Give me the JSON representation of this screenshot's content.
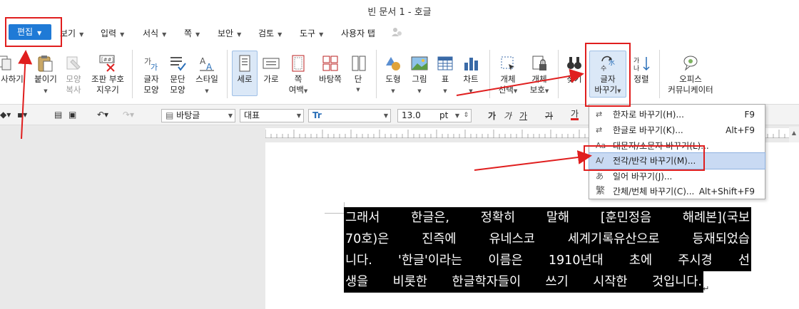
{
  "window": {
    "title": "빈 문서 1 - 호글"
  },
  "menu": {
    "edit": "편집",
    "items": [
      "보기",
      "입력",
      "서식",
      "쪽",
      "보안",
      "검토",
      "도구",
      "사용자 탭"
    ]
  },
  "ribbon": {
    "buttons": [
      {
        "id": "paste-special",
        "line1": "사하기",
        "line2": ""
      },
      {
        "id": "paste",
        "line1": "붙이기",
        "line2": ""
      },
      {
        "id": "format-copy",
        "line1": "모양",
        "line2": "복사"
      },
      {
        "id": "erase-marks",
        "line1": "조판 부호",
        "line2": "지우기"
      },
      {
        "id": "char-shape",
        "line1": "글자",
        "line2": "모양"
      },
      {
        "id": "para-shape",
        "line1": "문단",
        "line2": "모양"
      },
      {
        "id": "style",
        "line1": "스타일",
        "line2": ""
      },
      {
        "id": "portrait",
        "line1": "세로",
        "line2": ""
      },
      {
        "id": "landscape",
        "line1": "가로",
        "line2": ""
      },
      {
        "id": "page-margin",
        "line1": "쪽",
        "line2": "여백"
      },
      {
        "id": "background-page",
        "line1": "바탕쪽",
        "line2": ""
      },
      {
        "id": "columns",
        "line1": "단",
        "line2": ""
      },
      {
        "id": "shapes",
        "line1": "도형",
        "line2": ""
      },
      {
        "id": "picture",
        "line1": "그림",
        "line2": ""
      },
      {
        "id": "table",
        "line1": "표",
        "line2": ""
      },
      {
        "id": "chart",
        "line1": "차트",
        "line2": ""
      },
      {
        "id": "object-select",
        "line1": "개체",
        "line2": "선택"
      },
      {
        "id": "object-protect",
        "line1": "개체",
        "line2": "보호"
      },
      {
        "id": "find",
        "line1": "찾기",
        "line2": ""
      },
      {
        "id": "char-replace",
        "line1": "글자",
        "line2": "바꾸기"
      },
      {
        "id": "sort",
        "line1": "정렬",
        "line2": ""
      },
      {
        "id": "office-communicator",
        "line1": "오피스",
        "line2": "커뮤니케이터"
      }
    ]
  },
  "toolbar": {
    "style_value": "바탕글",
    "style_name": "대표",
    "font_value": "",
    "font_size": "13.0",
    "font_unit": "pt",
    "format_letters": [
      "가",
      "가",
      "가",
      "가",
      "가"
    ]
  },
  "dropdown": {
    "items": [
      {
        "label": "한자로 바꾸기(H)...",
        "shortcut": "F9"
      },
      {
        "label": "한글로 바꾸기(K)...",
        "shortcut": "Alt+F9"
      },
      {
        "label": "대문자/소문자 바꾸기(L)...",
        "shortcut": ""
      },
      {
        "label": "전각/반각 바꾸기(M)...",
        "shortcut": ""
      },
      {
        "label": "일어 바꾸기(J)...",
        "shortcut": ""
      },
      {
        "label": "간체/번체 바꾸기(C)...",
        "shortcut": "Alt+Shift+F9"
      }
    ]
  },
  "document": {
    "lines": [
      "그래서 한글은, 정확히 말해 [훈민정음 해례본](국보",
      "70호)은 진즉에 유네스코 세계기록유산으로 등재되었습",
      "니다. '한글'이라는 이름은 1910년대 초에 주시경 선",
      "생을 비롯한 한글학자들이 쓰기 시작한 것입니다."
    ]
  },
  "colors": {
    "accent": "#1f7ad6",
    "annotation": "#e01e1e",
    "hover": "#c9daf3"
  }
}
